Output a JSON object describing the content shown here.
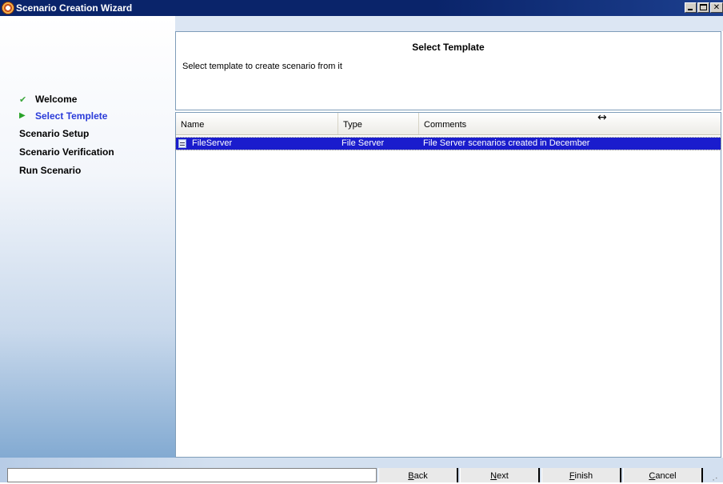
{
  "window": {
    "title": "Scenario Creation Wizard"
  },
  "steps": [
    {
      "label": "Welcome",
      "state": "done",
      "icon": "checkmark-icon"
    },
    {
      "label": "Select Templete",
      "state": "current",
      "icon": "play-arrow-icon"
    },
    {
      "label": "Scenario Setup",
      "state": "pending"
    },
    {
      "label": "Scenario Verification",
      "state": "pending"
    },
    {
      "label": "Run Scenario",
      "state": "pending"
    }
  ],
  "header": {
    "title": "Select Template",
    "subtitle": "Select template to create scenario from it"
  },
  "table": {
    "columns": [
      "Name",
      "Type",
      "Comments"
    ],
    "rows": [
      {
        "name": "FileServer",
        "type": "File Server",
        "comments": "File Server scenarios created in December",
        "selected": true
      }
    ]
  },
  "buttons": {
    "back": "Back",
    "next": "Next",
    "finish": "Finish",
    "cancel": "Cancel"
  },
  "colors": {
    "current_step": "#2a3bd9",
    "selection": "#1a1ccd",
    "titlebar": "#0a246a"
  }
}
